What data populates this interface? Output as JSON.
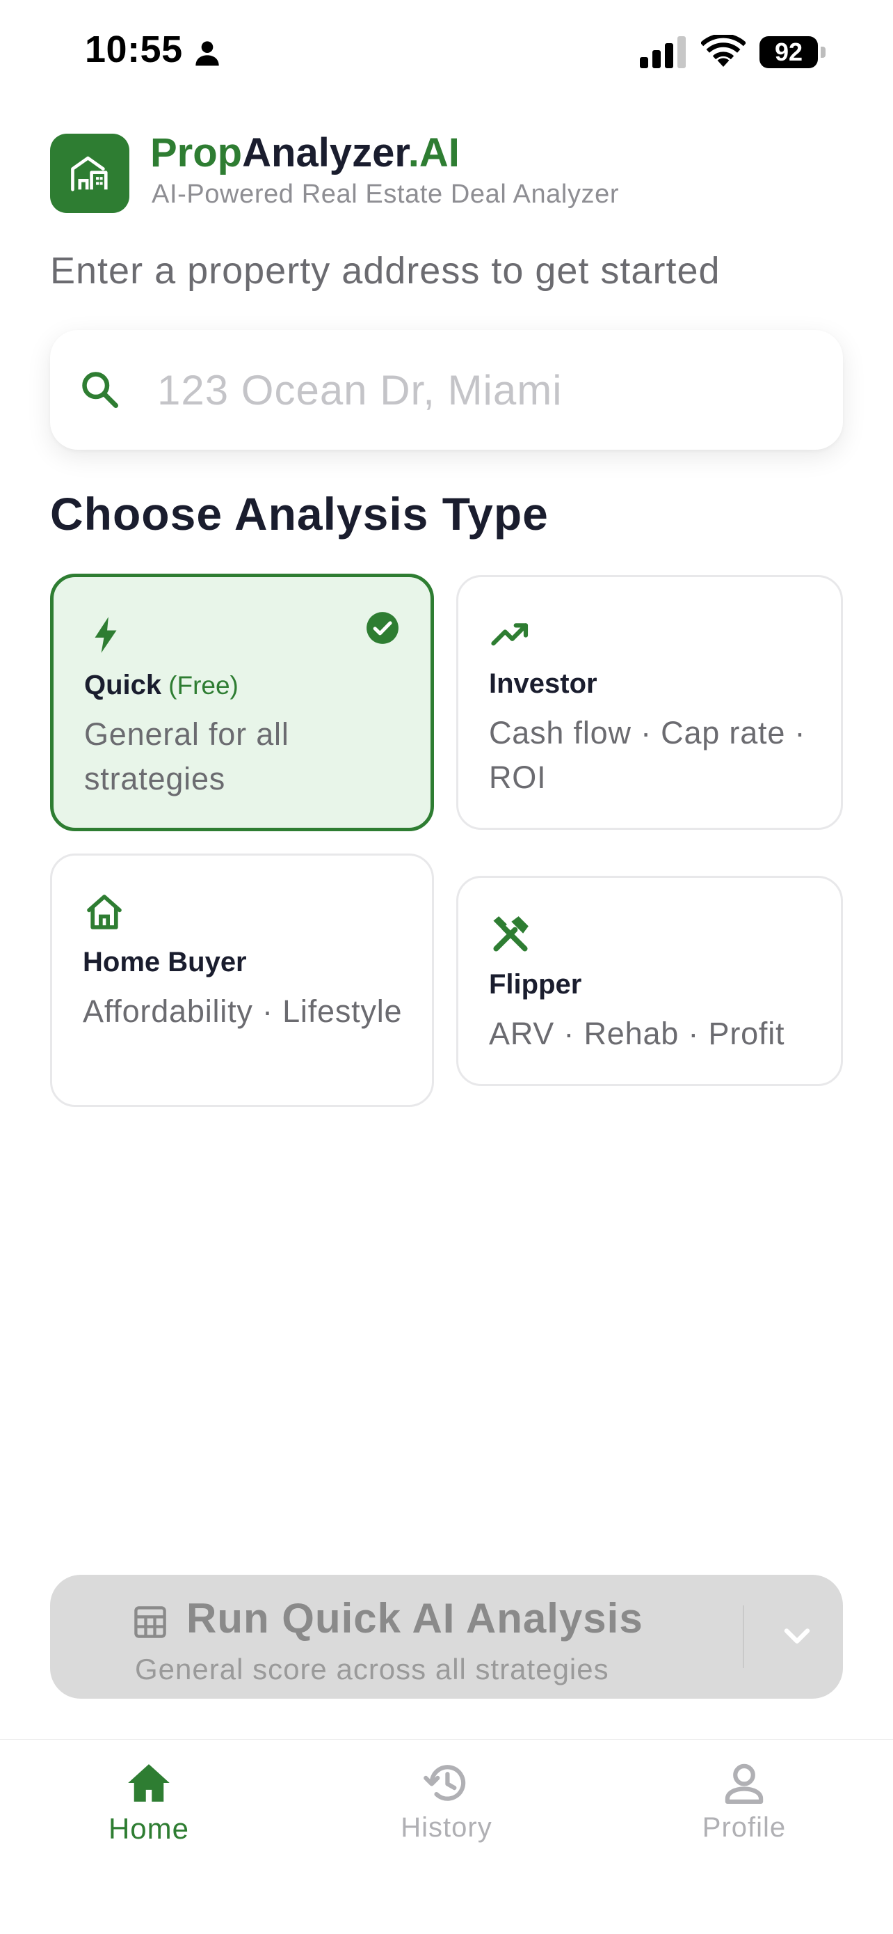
{
  "status_bar": {
    "time": "10:55",
    "battery": "92",
    "icons": [
      "person-icon",
      "cellular-signal-icon",
      "wifi-icon",
      "battery-icon"
    ]
  },
  "brand": {
    "name_part1": "Prop",
    "name_part2": "Analyzer",
    "name_part3": ".AI",
    "tagline": "AI-Powered Real Estate Deal Analyzer",
    "logo_icon": "house-chart-icon"
  },
  "prompt": "Enter a property address to get started",
  "search": {
    "placeholder": "123 Ocean Dr, Miami",
    "value": "",
    "icon": "search-icon"
  },
  "section_title": "Choose Analysis Type",
  "analysis_types": [
    {
      "title": "Quick",
      "tag": "(Free)",
      "description": "General for all strategies",
      "icon": "lightning-icon",
      "selected": true
    },
    {
      "title": "Investor",
      "tag": "",
      "description": "Cash flow · Cap rate · ROI",
      "icon": "trending-up-icon",
      "selected": false
    },
    {
      "title": "Home Buyer",
      "tag": "",
      "description": "Affordability · Lifestyle",
      "icon": "home-icon",
      "selected": false
    },
    {
      "title": "Flipper",
      "tag": "",
      "description": "ARV · Rehab · Profit",
      "icon": "tools-icon",
      "selected": false
    }
  ],
  "run_button": {
    "title": "Run Quick AI Analysis",
    "subtitle": "General score across all strategies",
    "icon": "calculator-icon",
    "dropdown_icon": "chevron-down-icon"
  },
  "tabs": [
    {
      "label": "Home",
      "icon": "home-tab-icon",
      "active": true
    },
    {
      "label": "History",
      "icon": "history-icon",
      "active": false
    },
    {
      "label": "Profile",
      "icon": "profile-icon",
      "active": false
    }
  ],
  "colors": {
    "primary": "#2e7d32",
    "selected_bg": "#e8f5e9",
    "text_dark": "#1a1d2e",
    "text_muted": "#6b6b70",
    "disabled_button": "#dadada",
    "inactive_tab": "#b0b0b4"
  }
}
